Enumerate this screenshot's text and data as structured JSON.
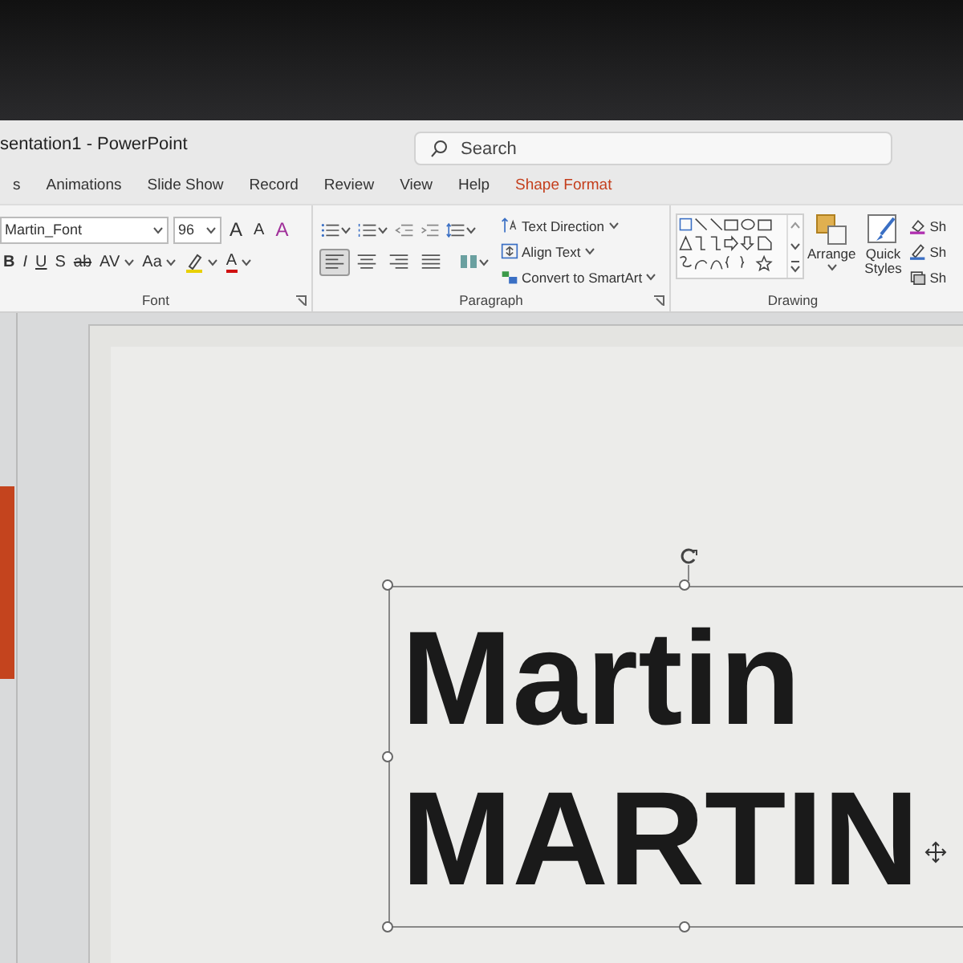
{
  "window": {
    "title": "sentation1 - PowerPoint"
  },
  "search": {
    "placeholder": "Search"
  },
  "tabs": [
    {
      "label": "s",
      "selected": false
    },
    {
      "label": "Animations",
      "selected": false
    },
    {
      "label": "Slide Show",
      "selected": false
    },
    {
      "label": "Record",
      "selected": false
    },
    {
      "label": "Review",
      "selected": false
    },
    {
      "label": "View",
      "selected": false
    },
    {
      "label": "Help",
      "selected": false
    },
    {
      "label": "Shape Format",
      "selected": true
    }
  ],
  "font_group": {
    "label": "Font",
    "font_name": "Martin_Font",
    "font_size": "96",
    "size_buttons": [
      {
        "kind": "grow",
        "label": "A"
      },
      {
        "kind": "shrink",
        "label": "A"
      },
      {
        "kind": "clear",
        "label": "A"
      }
    ],
    "format_buttons": [
      {
        "kind": "bold",
        "label": "B"
      },
      {
        "kind": "italic",
        "label": "I"
      },
      {
        "kind": "underline",
        "label": "U"
      },
      {
        "kind": "shadow",
        "label": "S"
      },
      {
        "kind": "strike",
        "label": "ab"
      },
      {
        "kind": "spacing",
        "label": "AV"
      },
      {
        "kind": "case",
        "label": "Aa"
      },
      {
        "kind": "highlight",
        "color": "#e8d000"
      },
      {
        "kind": "fontcolor",
        "label": "A",
        "color": "#d01010"
      }
    ]
  },
  "paragraph_group": {
    "label": "Paragraph",
    "alignment": [
      {
        "kind": "left",
        "selected": true
      },
      {
        "kind": "center",
        "selected": false
      },
      {
        "kind": "right",
        "selected": false
      },
      {
        "kind": "justify",
        "selected": false
      }
    ],
    "commands": [
      {
        "kind": "direction",
        "label": "Text Direction"
      },
      {
        "kind": "align",
        "label": "Align Text"
      },
      {
        "kind": "smartart",
        "label": "Convert to SmartArt"
      }
    ]
  },
  "drawing_group": {
    "label": "Drawing",
    "arrange": "Arrange",
    "quick_styles": "Quick Styles",
    "shape_items": [
      {
        "kind": "fill",
        "label": "Sh"
      },
      {
        "kind": "outline",
        "label": "Sh"
      },
      {
        "kind": "effects",
        "label": "Sh"
      }
    ]
  },
  "slide": {
    "text_lines": [
      "Martin",
      "MARTIN"
    ],
    "selected": true
  }
}
